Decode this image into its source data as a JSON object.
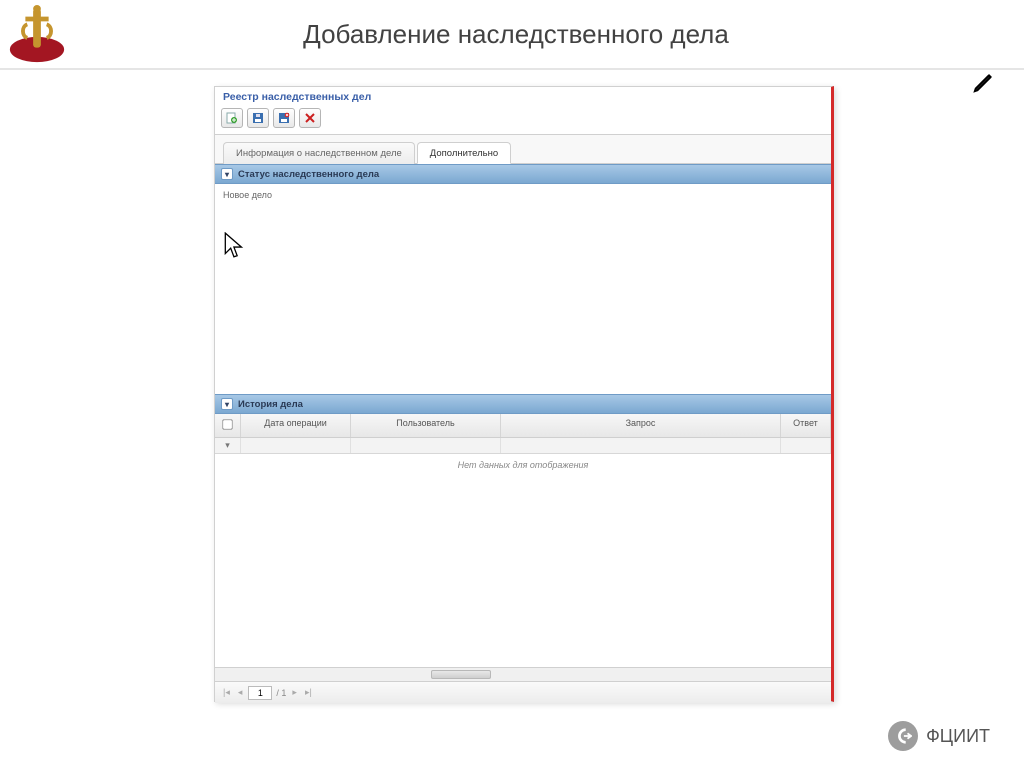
{
  "page": {
    "title": "Добавление наследственного дела"
  },
  "app": {
    "header": "Реестр наследственных дел"
  },
  "toolbar": {
    "new_icon": "plus",
    "save_icon": "diskette",
    "save_close_icon": "diskette-close",
    "close_icon": "x"
  },
  "tabs": [
    {
      "label": "Информация о наследственном деле"
    },
    {
      "label": "Дополнительно"
    }
  ],
  "status_section": {
    "title": "Статус наследственного дела",
    "value": "Новое дело"
  },
  "history_section": {
    "title": "История дела",
    "columns": {
      "date": "Дата операции",
      "user": "Пользователь",
      "request": "Запрос",
      "response": "Ответ"
    },
    "nodata": "Нет данных для отображения"
  },
  "pager": {
    "page": "1",
    "of_label": "/ 1"
  },
  "footer": {
    "brand": "ФЦИИТ"
  }
}
